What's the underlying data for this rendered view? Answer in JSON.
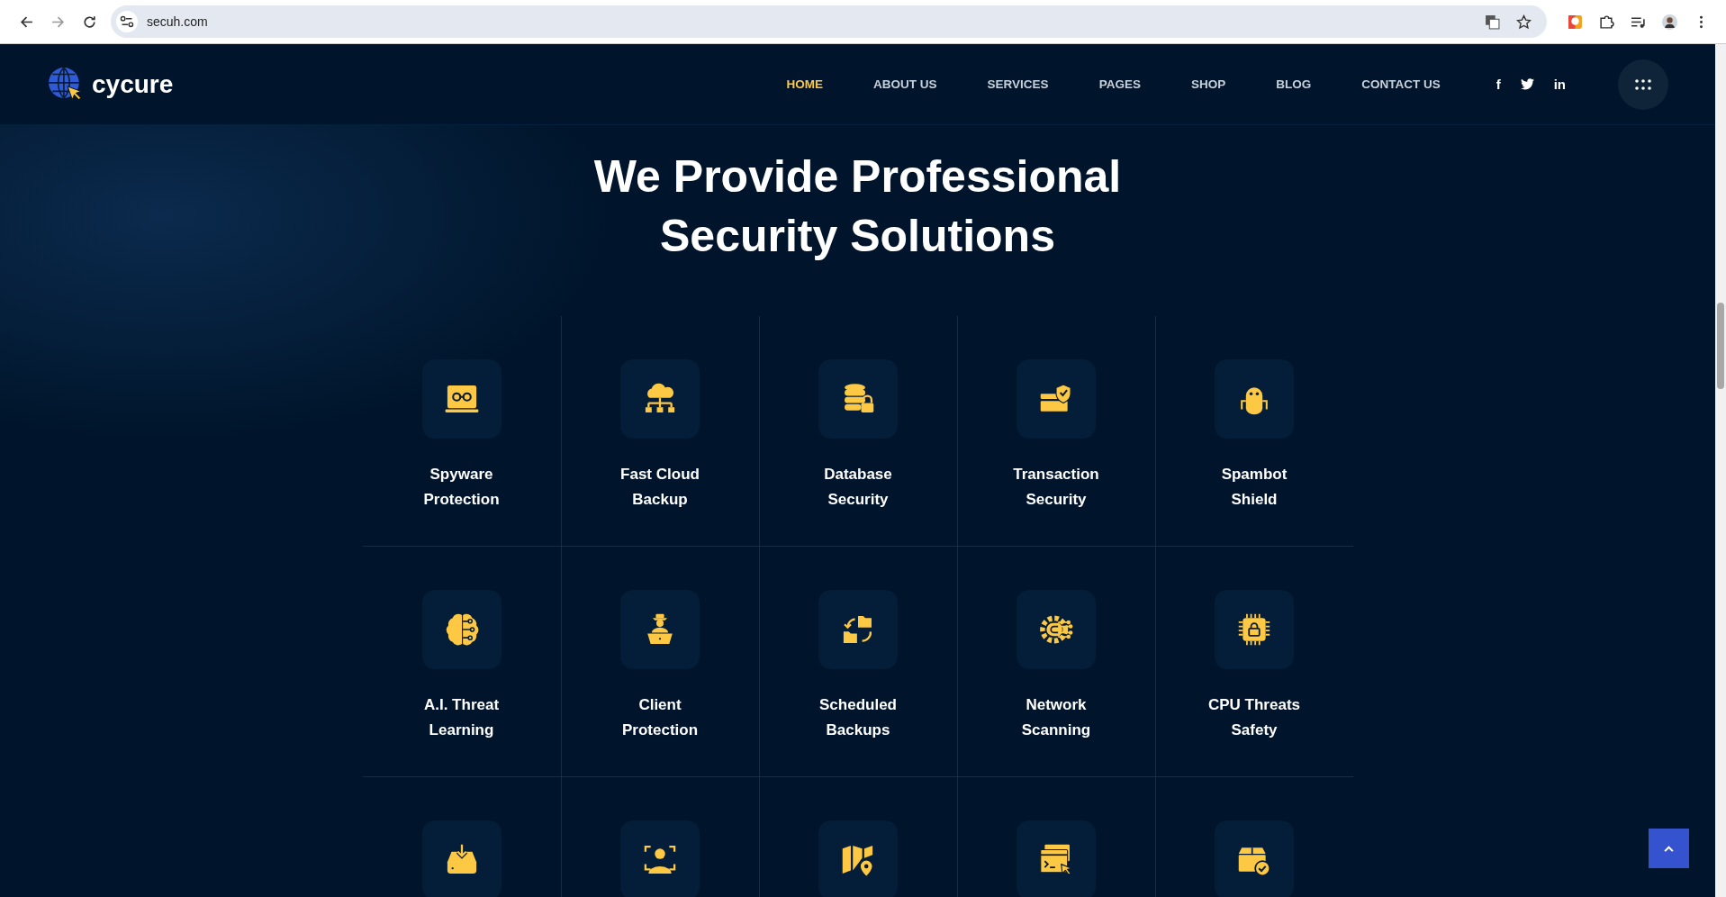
{
  "browser": {
    "url": "secuh.com"
  },
  "site": {
    "logo": "cycure"
  },
  "nav": [
    {
      "label": "HOME",
      "selected": true
    },
    {
      "label": "ABOUT US",
      "selected": false
    },
    {
      "label": "SERVICES",
      "selected": false
    },
    {
      "label": "PAGES",
      "selected": false
    },
    {
      "label": "SHOP",
      "selected": false
    },
    {
      "label": "BLOG",
      "selected": false
    },
    {
      "label": "CONTACT US",
      "selected": false
    }
  ],
  "social": [
    {
      "kind": "text",
      "label": "f"
    },
    {
      "kind": "bird"
    },
    {
      "kind": "text",
      "label": "in"
    }
  ],
  "heading": [
    "We Provide Professional",
    "Security Solutions"
  ],
  "services": [
    {
      "kind": "titled",
      "title": "Spyware Protection"
    },
    {
      "kind": "titled",
      "title": "Fast Cloud Backup"
    },
    {
      "kind": "titled",
      "title": "Database Security"
    },
    {
      "kind": "titled",
      "title": "Transaction Security"
    },
    {
      "kind": "titled",
      "title": "Spambot Shield"
    },
    {
      "kind": "titled",
      "title": "A.I. Threat Learning"
    },
    {
      "kind": "titled",
      "title": "Client Protection"
    },
    {
      "kind": "titled",
      "title": "Scheduled Backups"
    },
    {
      "kind": "titled",
      "title": "Network Scanning"
    },
    {
      "kind": "titled",
      "title": "CPU Threats Safety"
    },
    {
      "kind": "icon_only"
    },
    {
      "kind": "icon_only"
    },
    {
      "kind": "icon_only"
    },
    {
      "kind": "icon_only"
    },
    {
      "kind": "icon_only"
    }
  ]
}
